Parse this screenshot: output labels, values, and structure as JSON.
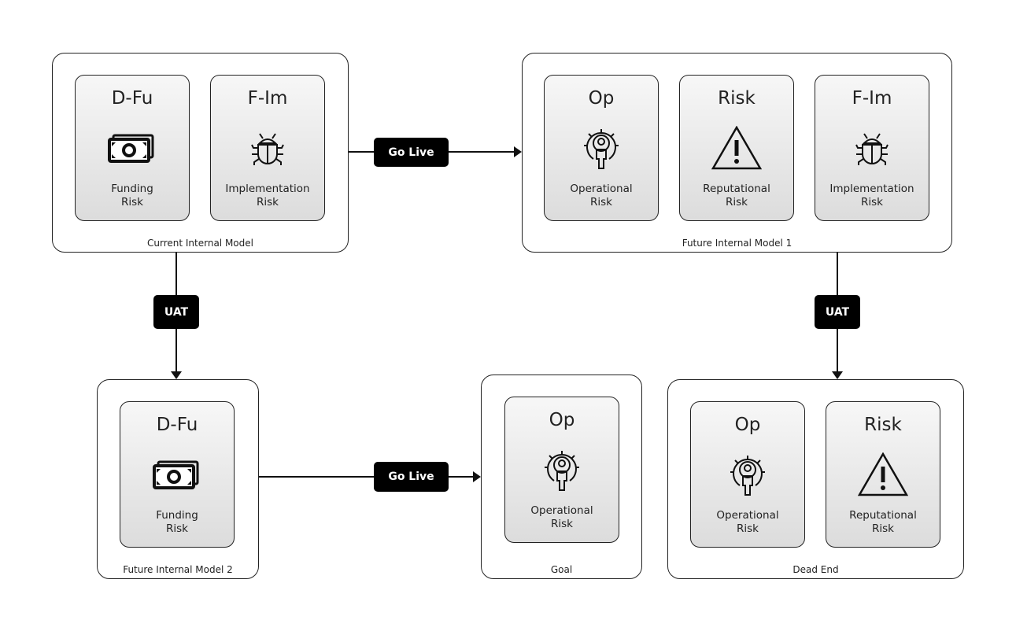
{
  "models": [
    {
      "id": "current",
      "label": "Current Internal Model",
      "cards": [
        {
          "title": "D-Fu",
          "icon": "money-icon",
          "label1": "Funding",
          "label2": "Risk"
        },
        {
          "title": "F-Im",
          "icon": "bug-icon",
          "label1": "Implementation",
          "label2": "Risk"
        }
      ]
    },
    {
      "id": "future1",
      "label": "Future Internal Model 1",
      "cards": [
        {
          "title": "Op",
          "icon": "gear-person-icon",
          "label1": "Operational",
          "label2": "Risk"
        },
        {
          "title": "Risk",
          "icon": "warning-icon",
          "label1": "Reputational",
          "label2": "Risk"
        },
        {
          "title": "F-Im",
          "icon": "bug-icon",
          "label1": "Implementation",
          "label2": "Risk"
        }
      ]
    },
    {
      "id": "future2",
      "label": "Future Internal Model 2",
      "cards": [
        {
          "title": "D-Fu",
          "icon": "money-icon",
          "label1": "Funding",
          "label2": "Risk"
        }
      ]
    },
    {
      "id": "goal",
      "label": "Goal",
      "cards": [
        {
          "title": "Op",
          "icon": "gear-person-icon",
          "label1": "Operational",
          "label2": "Risk"
        }
      ]
    },
    {
      "id": "deadend",
      "label": "Dead End",
      "cards": [
        {
          "title": "Op",
          "icon": "gear-person-icon",
          "label1": "Operational",
          "label2": "Risk"
        },
        {
          "title": "Risk",
          "icon": "warning-icon",
          "label1": "Reputational",
          "label2": "Risk"
        }
      ]
    }
  ],
  "transitions": [
    {
      "from": "Current Internal Model",
      "to": "Future Internal Model 1",
      "label": "Go Live"
    },
    {
      "from": "Current Internal Model",
      "to": "Future Internal Model 2",
      "label": "UAT"
    },
    {
      "from": "Future Internal Model 1",
      "to": "Dead End",
      "label": "UAT"
    },
    {
      "from": "Future Internal Model 2",
      "to": "Goal",
      "label": "Go Live"
    }
  ]
}
